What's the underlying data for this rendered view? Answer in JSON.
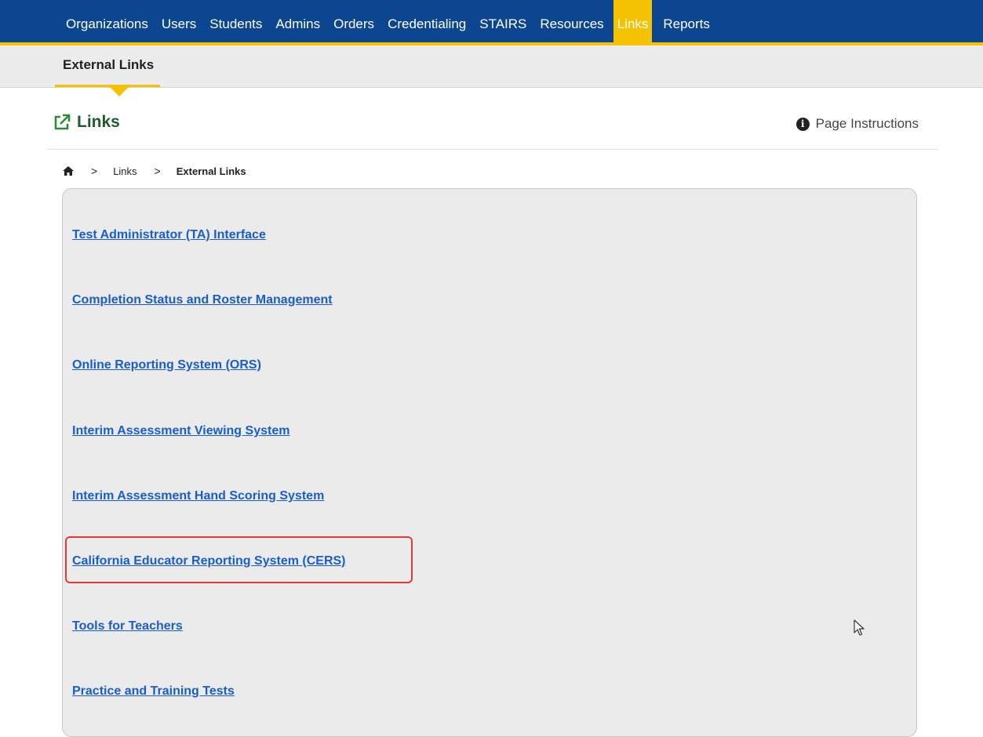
{
  "topnav": {
    "items": [
      {
        "label": "Organizations"
      },
      {
        "label": "Users"
      },
      {
        "label": "Students"
      },
      {
        "label": "Admins"
      },
      {
        "label": "Orders"
      },
      {
        "label": "Credentialing"
      },
      {
        "label": "STAIRS"
      },
      {
        "label": "Resources"
      },
      {
        "label": "Links",
        "active": true
      },
      {
        "label": "Reports"
      }
    ]
  },
  "subnav": {
    "tab_label": "External Links"
  },
  "page": {
    "title": "Links",
    "title_icon": "external-link-icon",
    "instructions_label": "Page Instructions",
    "instructions_icon": "info-circle-icon"
  },
  "breadcrumb": {
    "home_icon": "home-icon",
    "items": [
      "Links",
      "External Links"
    ]
  },
  "links": [
    {
      "label": "Test Administrator (TA) Interface"
    },
    {
      "label": "Completion Status and Roster Management"
    },
    {
      "label": "Online Reporting System (ORS)"
    },
    {
      "label": "Interim Assessment Viewing System"
    },
    {
      "label": "Interim Assessment Hand Scoring System"
    },
    {
      "label": "California Educator Reporting System (CERS)",
      "highlighted": true
    },
    {
      "label": "Tools for Teachers"
    },
    {
      "label": "Practice and Training Tests"
    }
  ],
  "colors": {
    "nav_bg": "#0d4690",
    "accent": "#f5c200",
    "title_green": "#1f5b2e",
    "link_blue": "#1a5dc9",
    "highlight_red": "#e53935"
  }
}
